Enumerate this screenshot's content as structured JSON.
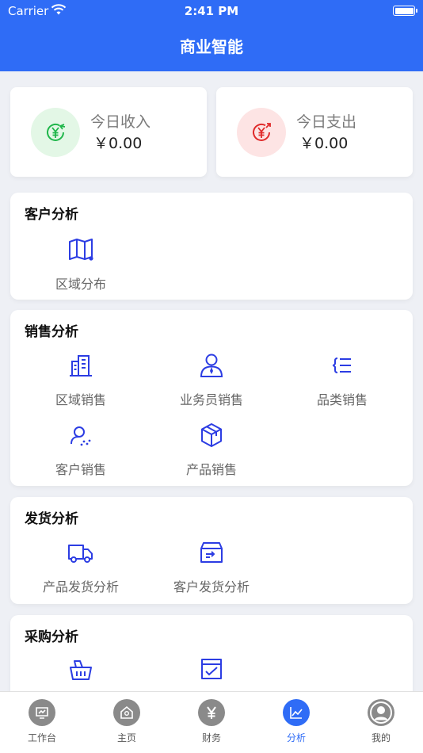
{
  "status_bar": {
    "carrier": "Carrier",
    "time": "2:41 PM"
  },
  "nav": {
    "title": "商业智能"
  },
  "summary": {
    "income": {
      "label": "今日收入",
      "value": "￥0.00"
    },
    "expense": {
      "label": "今日支出",
      "value": "￥0.00"
    }
  },
  "sections": {
    "customer": {
      "title": "客户分析",
      "items": [
        {
          "label": "区域分布",
          "icon": "map-icon"
        }
      ]
    },
    "sales": {
      "title": "销售分析",
      "items": [
        {
          "label": "区域销售",
          "icon": "building-icon"
        },
        {
          "label": "业务员销售",
          "icon": "salesperson-icon"
        },
        {
          "label": "品类销售",
          "icon": "category-list-icon"
        },
        {
          "label": "客户销售",
          "icon": "customer-icon"
        },
        {
          "label": "产品销售",
          "icon": "product-box-icon"
        }
      ]
    },
    "shipping": {
      "title": "发货分析",
      "items": [
        {
          "label": "产品发货分析",
          "icon": "truck-icon"
        },
        {
          "label": "客户发货分析",
          "icon": "delivery-box-icon"
        }
      ]
    },
    "purchase": {
      "title": "采购分析",
      "items": [
        {
          "label": "",
          "icon": "basket-icon"
        },
        {
          "label": "",
          "icon": "checklist-icon"
        }
      ]
    }
  },
  "tabs": [
    {
      "label": "工作台",
      "icon": "workbench-icon"
    },
    {
      "label": "主页",
      "icon": "home-icon"
    },
    {
      "label": "财务",
      "icon": "yen-icon"
    },
    {
      "label": "分析",
      "icon": "chart-icon",
      "active": true
    },
    {
      "label": "我的",
      "icon": "user-icon"
    }
  ],
  "colors": {
    "primary": "#2f6cf6",
    "icon_blue": "#2c3de3",
    "income_green": "#1fb64a",
    "expense_red": "#e02a2a"
  }
}
